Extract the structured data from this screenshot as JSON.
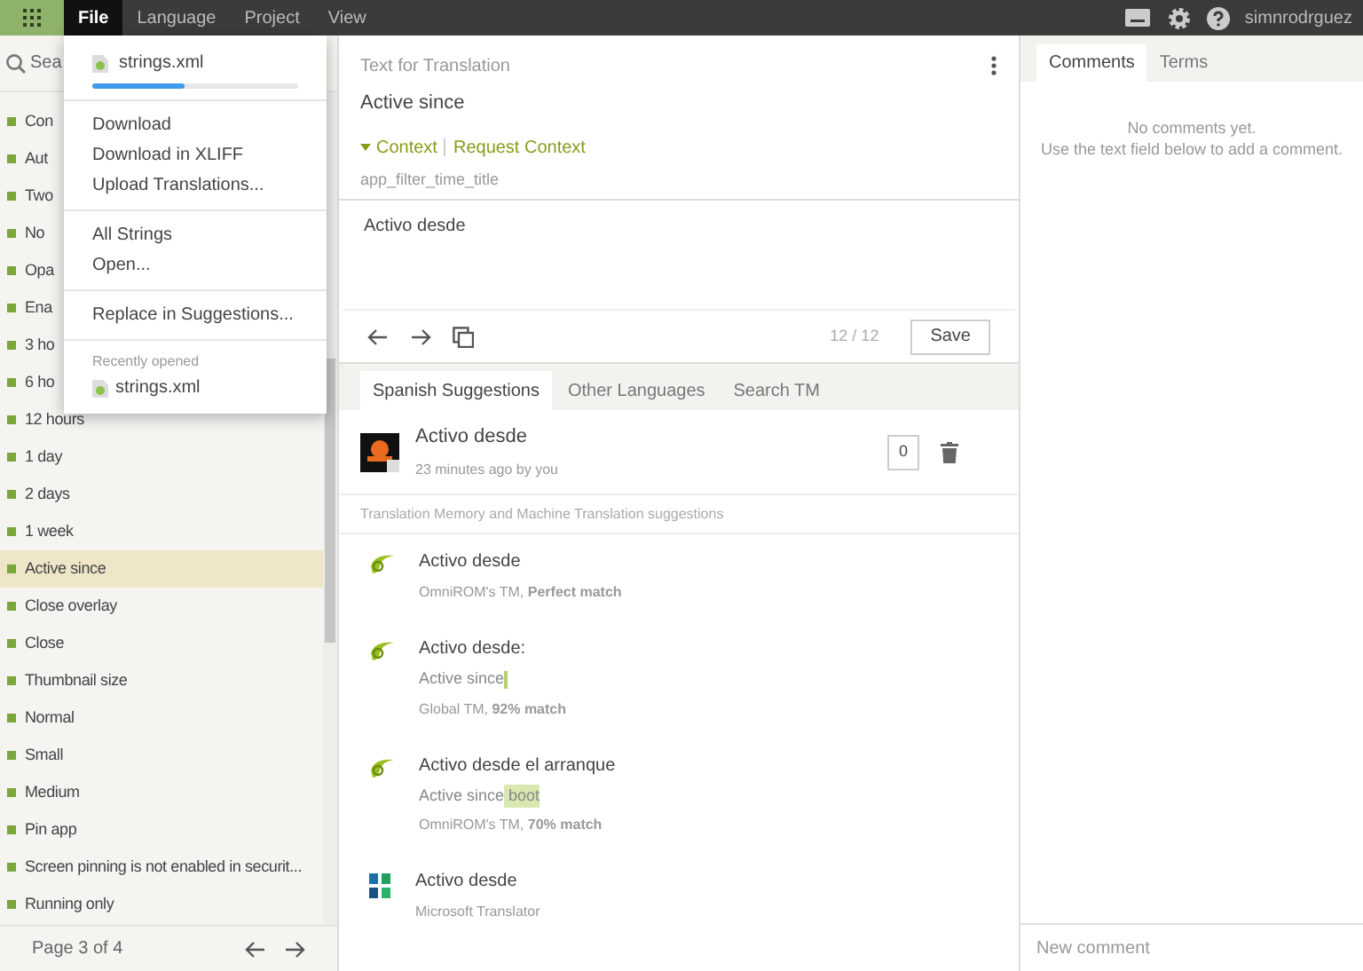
{
  "menubar": {
    "items": [
      {
        "label": "File",
        "selected": true
      },
      {
        "label": "Language",
        "selected": false
      },
      {
        "label": "Project",
        "selected": false
      },
      {
        "label": "View",
        "selected": false
      }
    ],
    "user": "simnrodrguez"
  },
  "file_menu": {
    "file": {
      "name": "strings.xml",
      "level": 0.45
    },
    "groups": [
      [
        "Download",
        "Download in XLIFF",
        "Upload Translations..."
      ],
      [
        "All Strings",
        "Open..."
      ],
      [
        "Replace in Suggestions..."
      ]
    ],
    "recent_heading": "Recently opened",
    "recent": [
      "strings.xml"
    ]
  },
  "sidebar": {
    "search": {
      "placeholder": "Sea"
    },
    "items": [
      {
        "label": "Con",
        "selected": false
      },
      {
        "label": "Aut",
        "selected": false
      },
      {
        "label": "Two",
        "selected": false
      },
      {
        "label": "No",
        "selected": false
      },
      {
        "label": "Opa",
        "selected": false
      },
      {
        "label": "Ena",
        "selected": false
      },
      {
        "label": "3 ho",
        "selected": false
      },
      {
        "label": "6 ho",
        "selected": false
      },
      {
        "label": "12 hours",
        "selected": false
      },
      {
        "label": "1 day",
        "selected": false
      },
      {
        "label": "2 days",
        "selected": false
      },
      {
        "label": "1 week",
        "selected": false
      },
      {
        "label": "Active since",
        "selected": true
      },
      {
        "label": "Close overlay",
        "selected": false
      },
      {
        "label": "Close",
        "selected": false
      },
      {
        "label": "Thumbnail size",
        "selected": false
      },
      {
        "label": "Normal",
        "selected": false
      },
      {
        "label": "Small",
        "selected": false
      },
      {
        "label": "Medium",
        "selected": false
      },
      {
        "label": "Pin app",
        "selected": false
      },
      {
        "label": "Screen pinning is not enabled in securit...",
        "selected": false
      },
      {
        "label": "Running only",
        "selected": false
      }
    ],
    "pager": "Page 3 of 4"
  },
  "editor": {
    "header": "Text for Translation",
    "source": "Active since",
    "context_link": "Context",
    "request_context": "Request Context",
    "key": "app_filter_time_title",
    "translation": "Activo desde",
    "counter": "12 / 12",
    "save": "Save"
  },
  "suggestion_tabs": [
    {
      "label": "Spanish Suggestions",
      "selected": true
    },
    {
      "label": "Other Languages",
      "selected": false
    },
    {
      "label": "Search TM",
      "selected": false
    }
  ],
  "own_suggestion": {
    "text": "Activo desde",
    "meta": "23 minutes ago by you",
    "votes": "0"
  },
  "tm_heading": "Translation Memory and Machine Translation suggestions",
  "suggestions": [
    {
      "kind": "tm",
      "text": "Activo desde",
      "meta": "OmniROM's TM, **Perfect match**"
    },
    {
      "kind": "tm",
      "text": "Activo desde:",
      "source": [
        {
          "text": "Active since",
          "diff": false
        }
      ],
      "insertion_mark": true,
      "meta": "Global TM, **92% match**"
    },
    {
      "kind": "tm",
      "text": "Activo desde el arranque",
      "source": [
        {
          "text": "Active since",
          "diff": false
        },
        {
          "text": " boot",
          "diff": true
        }
      ],
      "meta": "OmniROM's TM, **70% match**"
    },
    {
      "kind": "mt",
      "text": "Activo desde",
      "meta": "Microsoft Translator"
    }
  ],
  "right_tabs": [
    {
      "label": "Comments",
      "selected": true
    },
    {
      "label": "Terms",
      "selected": false
    }
  ],
  "comments_empty": [
    "No comments yet.",
    "Use the text field below to add a comment."
  ],
  "new_comment": {
    "placeholder": "New comment"
  }
}
